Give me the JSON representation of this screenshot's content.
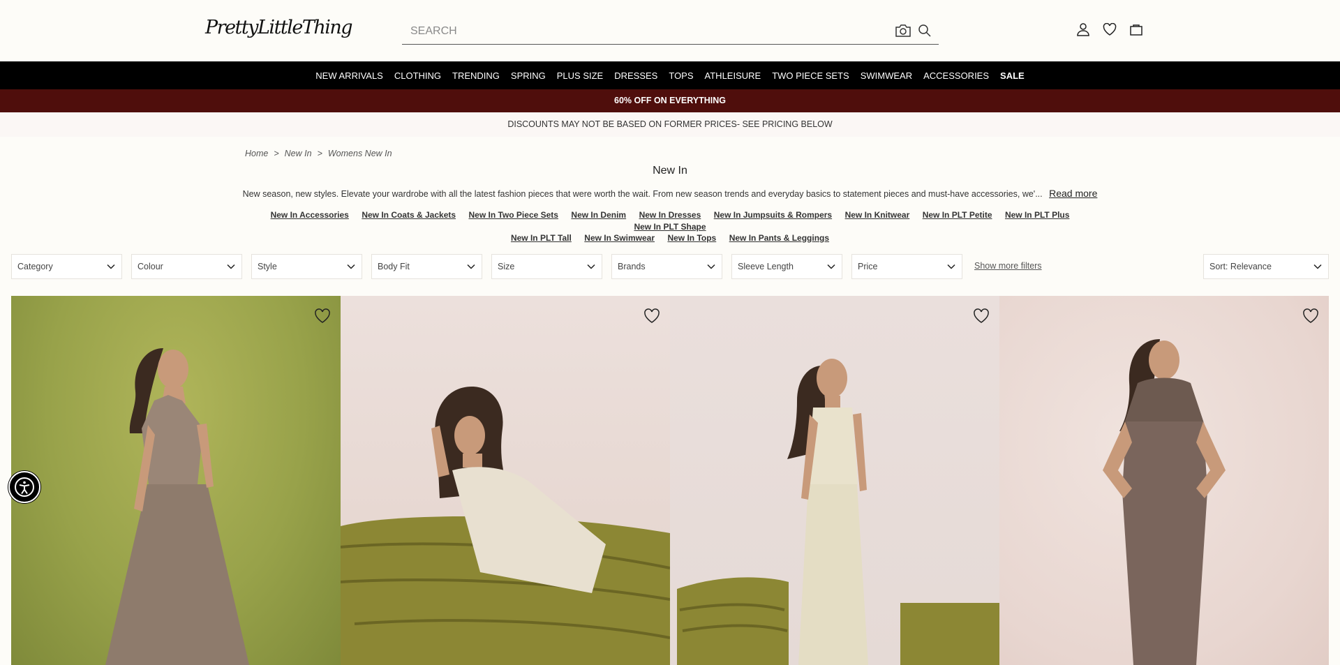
{
  "header": {
    "logo_text": "PrettyLittleThing",
    "search_placeholder": "SEARCH",
    "icons": [
      "camera-icon",
      "search-icon",
      "account-icon",
      "wishlist-icon",
      "bag-icon"
    ]
  },
  "nav": {
    "items": [
      "NEW ARRIVALS",
      "CLOTHING",
      "TRENDING",
      "SPRING",
      "PLUS SIZE",
      "DRESSES",
      "TOPS",
      "ATHLEISURE",
      "TWO PIECE SETS",
      "SWIMWEAR",
      "ACCESSORIES",
      "SALE"
    ]
  },
  "promo": {
    "text": "60% OFF ON EVERYTHING",
    "color": "#4f0e0c"
  },
  "notice": {
    "text": "DISCOUNTS MAY NOT BE BASED ON FORMER PRICES- SEE PRICING BELOW"
  },
  "breadcrumb": [
    "Home",
    ">",
    "New In",
    ">",
    "Womens New In"
  ],
  "page": {
    "title": "New In",
    "description": "New season, new styles. Elevate your wardrobe with all the latest fashion pieces that were worth the wait. From new season trends and everyday basics to statement pieces and must-have accessories, we'...",
    "read_more": "Read more"
  },
  "sublinks": [
    "New In Accessories",
    "New In Coats & Jackets",
    "New In Two Piece Sets",
    "New In Denim",
    "New In Dresses",
    "New In Jumpsuits & Rompers",
    "New In Knitwear",
    "New In PLT Petite",
    "New In PLT Plus",
    "New In PLT Shape",
    "New In PLT Tall",
    "New In Swimwear",
    "New In Tops",
    "New In Pants & Leggings"
  ],
  "filters": {
    "items": [
      "Category",
      "Colour",
      "Style",
      "Body Fit",
      "Size",
      "Brands",
      "Sleeve Length",
      "Price"
    ],
    "show_more": "Show more filters",
    "sort": "Sort: Relevance"
  },
  "products": [
    {
      "desc": "halter-neck taupe maxi dress on green backdrop"
    },
    {
      "desc": "cream strapless dress reclining on olive leather sofa"
    },
    {
      "desc": "cream peplum top and maxi skirt set"
    },
    {
      "desc": "mocha cowl-neck sleeveless maxi dress"
    }
  ]
}
